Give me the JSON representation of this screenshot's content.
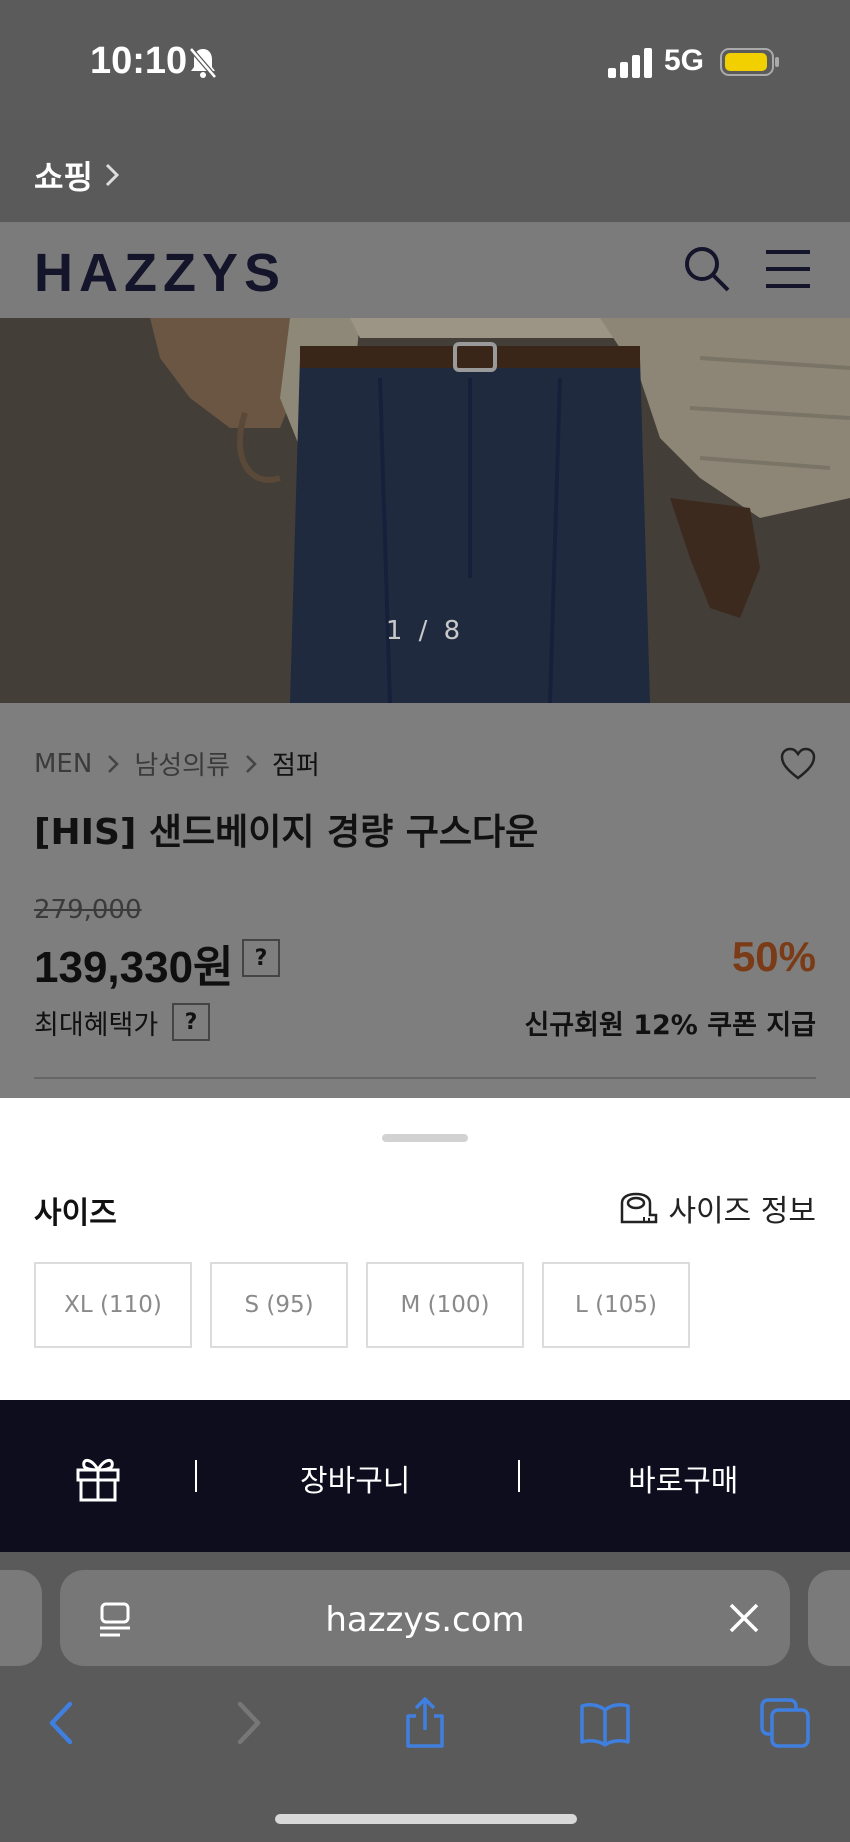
{
  "status_bar": {
    "time": "10:10",
    "network": "5G"
  },
  "top_link": {
    "label": "쇼핑"
  },
  "brand": {
    "name": "HAZZYS"
  },
  "gallery": {
    "pager": "1 / 8"
  },
  "breadcrumb": [
    "MEN",
    "남성의류",
    "점퍼"
  ],
  "product": {
    "name": "[HIS] 샌드베이지 경량 구스다운",
    "original_price": "279,000",
    "price": "139,330원",
    "discount": "50%",
    "max_benefit_label": "최대혜택가",
    "coupon_text": "신규회원 12% 쿠폰 지급",
    "help_symbol": "?"
  },
  "size_sheet": {
    "title": "사이즈",
    "info_label": "사이즈 정보",
    "options": [
      "XL (110)",
      "S (95)",
      "M (100)",
      "L (105)"
    ]
  },
  "buy_bar": {
    "cart_label": "장바구니",
    "buy_label": "바로구매"
  },
  "browser": {
    "url": "hazzys.com"
  },
  "colors": {
    "brand_navy": "#0e0d1e",
    "discount": "#7a3b16",
    "safari_blue": "#3f7fe0"
  }
}
